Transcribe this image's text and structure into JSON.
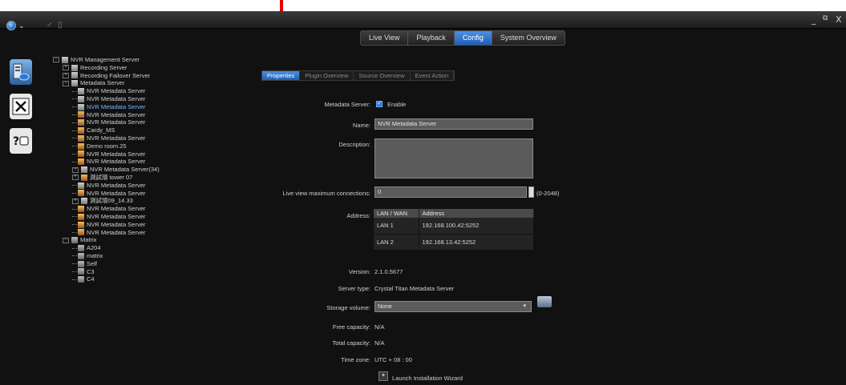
{
  "window_controls": {
    "minimize": "_",
    "restore": "⧉",
    "close": "X"
  },
  "topnav": {
    "tabs": [
      "Live View",
      "Playback",
      "Config",
      "System Overview"
    ],
    "active": "Config"
  },
  "tree": [
    {
      "label": "NVR Management Server",
      "level": 0,
      "toggle": "⊟",
      "icon": "server"
    },
    {
      "label": "Recording Server",
      "level": 1,
      "toggle": "⊞",
      "icon": "server"
    },
    {
      "label": "Recording Failover Server",
      "level": 1,
      "toggle": "⊞",
      "icon": "server"
    },
    {
      "label": "Metadata Server",
      "level": 1,
      "toggle": "⊟",
      "icon": "server"
    },
    {
      "label": "NVR Metadata Server",
      "level": 2,
      "icon": "server"
    },
    {
      "label": "NVR Metadata Server",
      "level": 2,
      "icon": "server"
    },
    {
      "label": "NVR Metadata Server",
      "level": 2,
      "icon": "server",
      "selected": true
    },
    {
      "label": "NVR Metadata Server",
      "level": 2,
      "icon": "meta"
    },
    {
      "label": "NVR Metadata Server",
      "level": 2,
      "icon": "meta"
    },
    {
      "label": "Cardy_MS",
      "level": 2,
      "icon": "meta"
    },
    {
      "label": "NVR Metadata Server",
      "level": 2,
      "icon": "meta"
    },
    {
      "label": "Demo room.25",
      "level": 2,
      "icon": "meta"
    },
    {
      "label": "NVR Metadata Server",
      "level": 2,
      "icon": "meta"
    },
    {
      "label": "NVR Metadata Server",
      "level": 2,
      "icon": "meta"
    },
    {
      "label": "NVR Metadata Server(34)",
      "level": 2,
      "toggle": "⊞",
      "icon": "server"
    },
    {
      "label": "測試環 tower 07",
      "level": 2,
      "toggle": "⊞",
      "icon": "meta"
    },
    {
      "label": "NVR Metadata Server",
      "level": 2,
      "icon": "server"
    },
    {
      "label": "NVR Metadata Server",
      "level": 2,
      "icon": "meta"
    },
    {
      "label": "測試環09_14.33",
      "level": 2,
      "toggle": "⊞",
      "icon": "server"
    },
    {
      "label": "NVR Metadata Server",
      "level": 2,
      "icon": "meta"
    },
    {
      "label": "NVR Metadata Server",
      "level": 2,
      "icon": "meta"
    },
    {
      "label": "NVR Metadata Server",
      "level": 2,
      "icon": "meta"
    },
    {
      "label": "NVR Metadata Server",
      "level": 2,
      "icon": "meta"
    },
    {
      "label": "Matrix",
      "level": 1,
      "toggle": "⊟",
      "icon": "matrix"
    },
    {
      "label": "A204",
      "level": 2,
      "icon": "matrix"
    },
    {
      "label": "matrix",
      "level": 2,
      "icon": "matrix"
    },
    {
      "label": "Self",
      "level": 2,
      "icon": "matrix"
    },
    {
      "label": "C3",
      "level": 2,
      "icon": "matrix"
    },
    {
      "label": "C4",
      "level": 2,
      "icon": "matrix"
    }
  ],
  "subtabs": {
    "items": [
      "Properties",
      "Plugin Overview",
      "Source Overview",
      "Event Action"
    ],
    "active": "Properties"
  },
  "form": {
    "metadata_server_label": "Metadata Server:",
    "enable_label": "Enable",
    "enable_checked": true,
    "name_label": "Name:",
    "name_value": "NVR Metadata Server",
    "description_label": "Description:",
    "description_value": "",
    "live_view_label": "Live view maximum connections:",
    "live_view_value": "0",
    "live_view_range": "(0-2048)",
    "address_label": "Address:",
    "address_headers": [
      "LAN / WAN",
      "Address"
    ],
    "address_rows": [
      {
        "type": "LAN 1",
        "address": "192.168.100.42:5252"
      },
      {
        "type": "LAN 2",
        "address": "192.168.13.42:5252"
      }
    ],
    "version_label": "Version:",
    "version_value": "2.1.0.5677",
    "server_type_label": "Server type:",
    "server_type_value": "Crystal Titan Metadata Server",
    "storage_label": "Storage volume:",
    "storage_value": "None",
    "free_label": "Free capacity:",
    "free_value": "N/A",
    "total_label": "Total capacity:",
    "total_value": "N/A",
    "timezone_label": "Time zone:",
    "timezone_value": "UTC + 08 : 00",
    "wizard_label": "Launch Installation Wizard"
  }
}
